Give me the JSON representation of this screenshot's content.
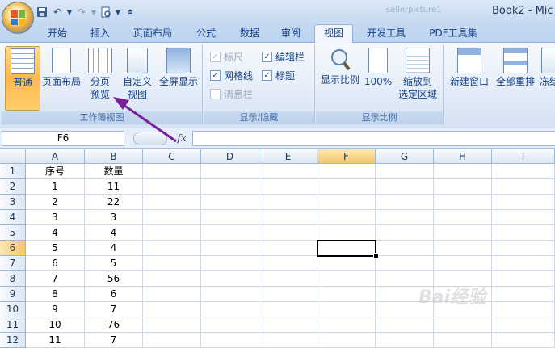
{
  "window": {
    "title": "Book2 - Mic",
    "file_label": "sellerpicture1"
  },
  "tabs": [
    {
      "label": "开始"
    },
    {
      "label": "插入"
    },
    {
      "label": "页面布局"
    },
    {
      "label": "公式"
    },
    {
      "label": "数据"
    },
    {
      "label": "审阅"
    },
    {
      "label": "视图",
      "active": true
    },
    {
      "label": "开发工具"
    },
    {
      "label": "PDF工具集"
    }
  ],
  "ribbon": {
    "workbook_views": {
      "label": "工作簿视图",
      "normal": "普通",
      "page_layout": "页面布局",
      "page_break_1": "分页",
      "page_break_2": "预览",
      "custom_1": "自定义",
      "custom_2": "视图",
      "full_screen": "全屏显示"
    },
    "show_hide": {
      "label": "显示/隐藏",
      "ruler": "标尺",
      "formula_bar": "编辑栏",
      "gridlines": "网格线",
      "headings": "标题",
      "message_bar": "消息栏"
    },
    "zoom": {
      "label": "显示比例",
      "zoom": "显示比例",
      "hundred": "100%",
      "fit_1": "缩放到",
      "fit_2": "选定区域"
    },
    "window": {
      "new_window": "新建窗口",
      "arrange_all": "全部重排",
      "freeze": "冻结"
    }
  },
  "formula_bar": {
    "name_box": "F6",
    "fx": "fx"
  },
  "grid": {
    "columns": [
      "A",
      "B",
      "C",
      "D",
      "E",
      "F",
      "G",
      "H",
      "I"
    ],
    "rows": [
      "1",
      "2",
      "3",
      "4",
      "5",
      "6",
      "7",
      "8",
      "9",
      "10",
      "11",
      "12"
    ],
    "selected_cell": "F6",
    "col_a": [
      "序号",
      "1",
      "2",
      "3",
      "4",
      "5",
      "6",
      "7",
      "8",
      "9",
      "10",
      "11"
    ],
    "col_b": [
      "数量",
      "11",
      "22",
      "3",
      "4",
      "4",
      "5",
      "56",
      "6",
      "7",
      "76",
      "7"
    ]
  },
  "watermark": "Bai经验"
}
